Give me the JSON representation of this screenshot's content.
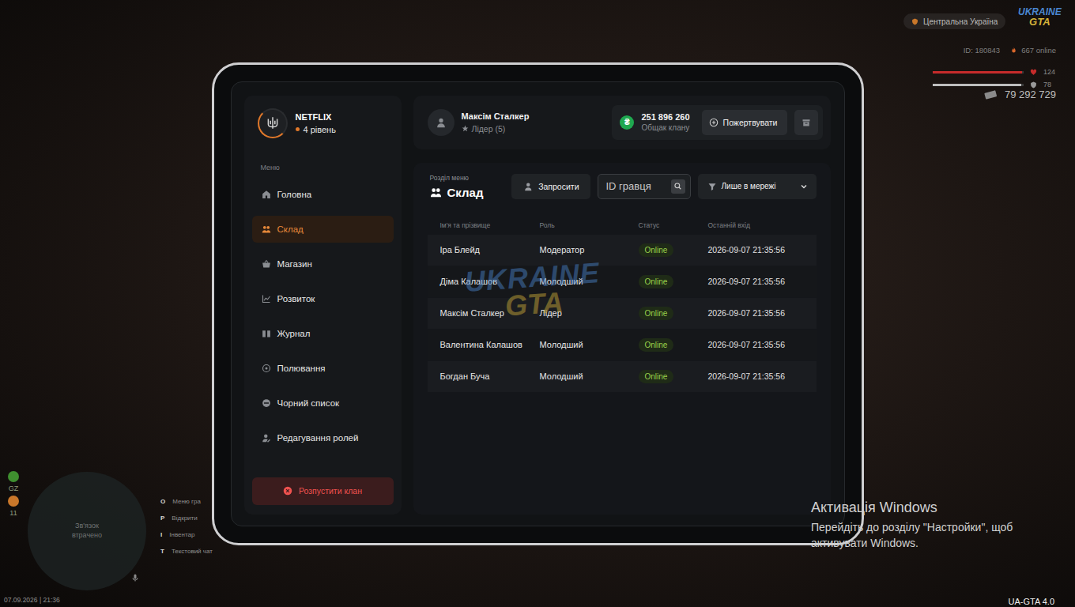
{
  "hud": {
    "server": "Центральна Україна",
    "logo": {
      "top": "UKRAINE",
      "bottom": "GTA"
    },
    "player_id": "ID: 180843",
    "online": "667 online",
    "health": {
      "reading": "124",
      "level": 0.98
    },
    "armor": {
      "reading": "78",
      "level": 0.97
    },
    "money": "79 292 729",
    "indicators": [
      {
        "label": "GZ",
        "color": "#3f8f2f"
      },
      {
        "label": "11",
        "color": "#c9772a"
      }
    ],
    "minimap": {
      "status": "Зв'язок втрачено"
    },
    "hints": [
      {
        "key": "O",
        "label": "Меню гра"
      },
      {
        "key": "P",
        "label": "Відкрити"
      },
      {
        "key": "I",
        "label": "Інвентар"
      },
      {
        "key": "T",
        "label": "Текстовий чат"
      }
    ],
    "datetime": "07.09.2026 | 21:36",
    "version": "UA-GTA 4.0"
  },
  "clan": {
    "name": "NETFLIX",
    "level": "4 рівень"
  },
  "sidebar": {
    "section": "Меню",
    "items": [
      {
        "label": "Головна",
        "selected": false
      },
      {
        "label": "Склад",
        "selected": true
      },
      {
        "label": "Магазин",
        "selected": false
      },
      {
        "label": "Розвиток",
        "selected": false
      },
      {
        "label": "Журнал",
        "selected": false
      },
      {
        "label": "Полювання",
        "selected": false
      },
      {
        "label": "Чорний список",
        "selected": false
      },
      {
        "label": "Редагування ролей",
        "selected": false
      }
    ],
    "disband": "Розпустити клан"
  },
  "user": {
    "name": "Максім Сталкер",
    "role": "Лідер (5)"
  },
  "treasury": {
    "currency": "₴",
    "amount": "251 896 260",
    "label": "Общак клану",
    "donate": "Пожертвувати"
  },
  "section": {
    "caption": "Розділ меню",
    "title": "Склад"
  },
  "toolbar": {
    "invite": "Запросити",
    "search_placeholder": "ID гравця",
    "filter": "Лише в мережі"
  },
  "table": {
    "columns": [
      "Ім'я та прізвище",
      "Роль",
      "Статус",
      "Останній вхід"
    ],
    "rows": [
      {
        "name": "Іра Блейд",
        "role": "Модератор",
        "status": "Online",
        "last_login": "2026-09-07 21:35:56"
      },
      {
        "name": "Діма Калашов",
        "role": "Молодший",
        "status": "Online",
        "last_login": "2026-09-07 21:35:56"
      },
      {
        "name": "Максім Сталкер",
        "role": "Лідер",
        "status": "Online",
        "last_login": "2026-09-07 21:35:56"
      },
      {
        "name": "Валентина Калашов",
        "role": "Молодший",
        "status": "Online",
        "last_login": "2026-09-07 21:35:56"
      },
      {
        "name": "Богдан Буча",
        "role": "Молодший",
        "status": "Online",
        "last_login": "2026-09-07 21:35:56"
      }
    ]
  },
  "watermark": {
    "top": "UKRAINE",
    "bottom": "GTA"
  },
  "os_notice": {
    "title": "Активація Windows",
    "text": "Перейдіть до розділу \"Настройки\", щоб активувати Windows."
  }
}
